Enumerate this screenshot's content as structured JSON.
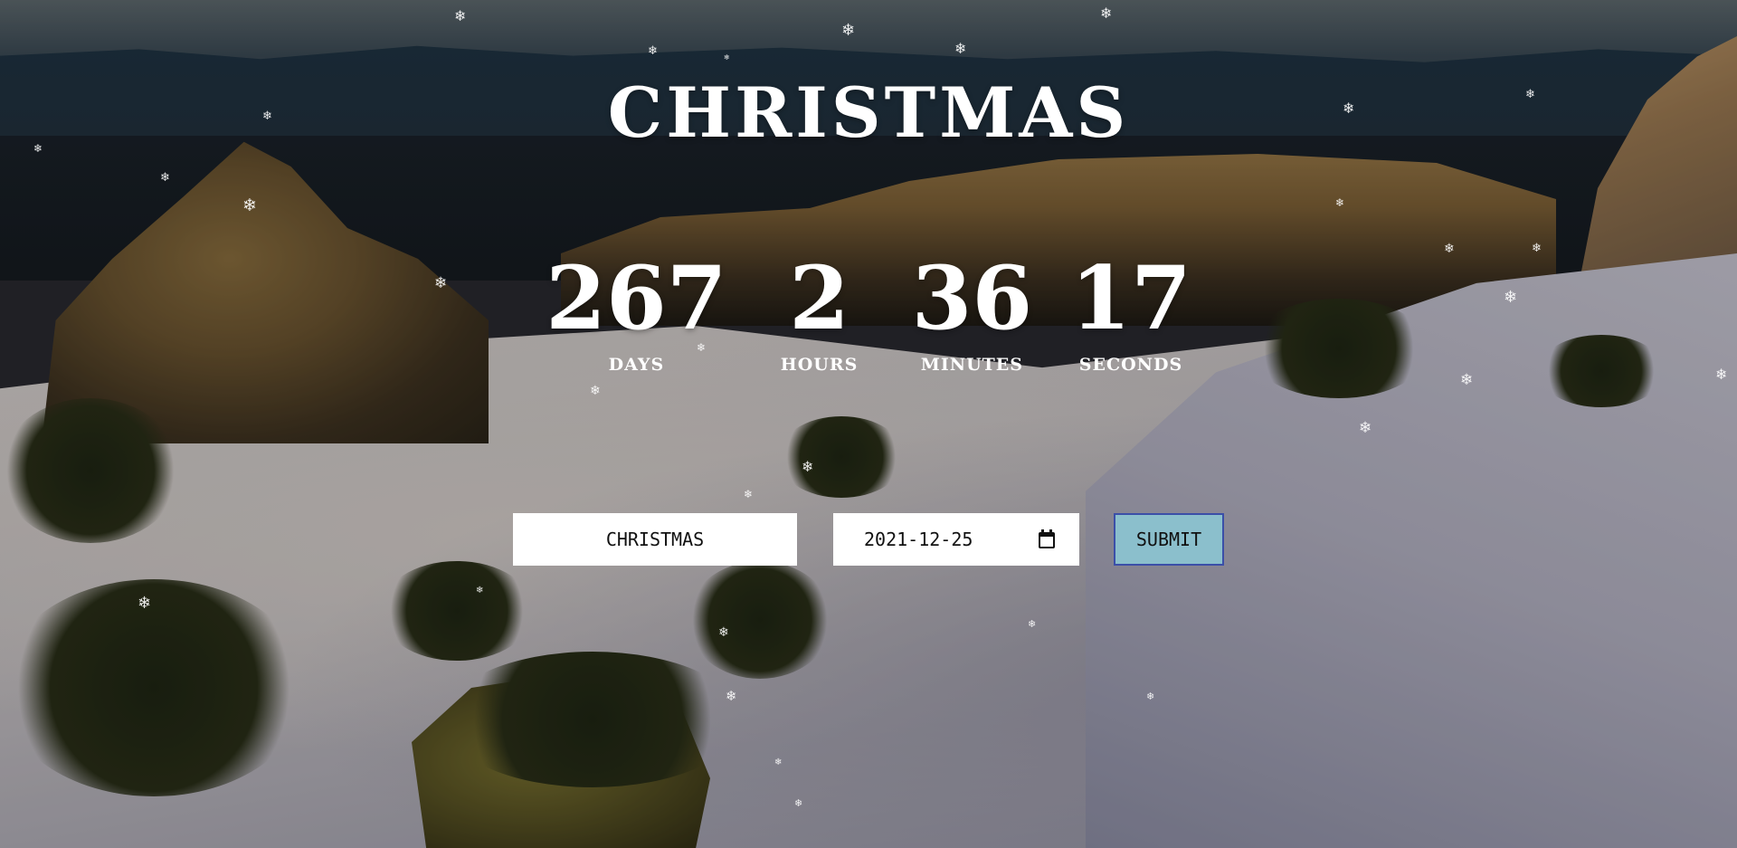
{
  "page": {
    "title": "CHRISTMAS"
  },
  "countdown": [
    {
      "value": "267",
      "label": "DAYS"
    },
    {
      "value": "2",
      "label": "HOURS"
    },
    {
      "value": "36",
      "label": "MINUTES"
    },
    {
      "value": "17",
      "label": "SECONDS"
    }
  ],
  "form": {
    "event_value": "CHRISTMAS",
    "date_value": "2021-12-25",
    "submit_label": "SUBMIT"
  },
  "icons": {
    "calendar": "calendar-icon",
    "snowflake": "❄"
  },
  "colors": {
    "text": "#ffffff",
    "submit_bg": "#8bbfcc",
    "submit_border": "#3b4fa8"
  }
}
